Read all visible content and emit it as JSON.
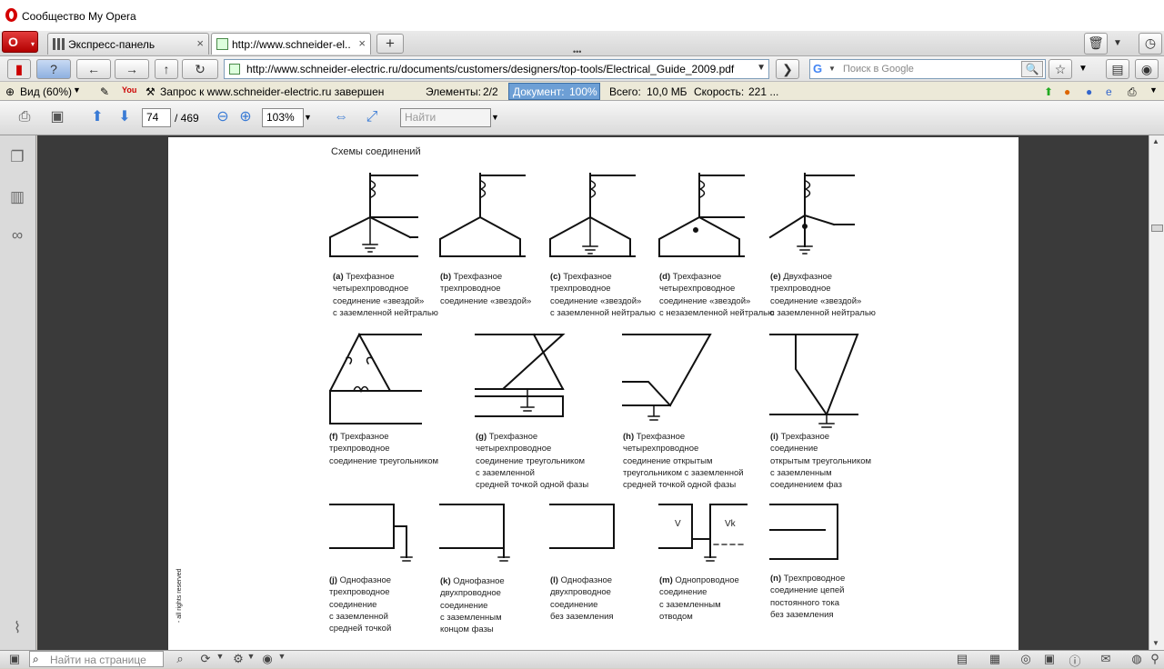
{
  "window": {
    "title": "Сообщество My Opera"
  },
  "menu": {
    "label": "O",
    "arrow": "▾"
  },
  "tabs": [
    {
      "label": "Экспресс-панель",
      "close": "×"
    },
    {
      "label": "http://www.schneider-el...",
      "close": "×"
    }
  ],
  "add_tab": "+",
  "tab_more": "•••",
  "nav": {
    "back": "←",
    "forward": "→",
    "up": "↑",
    "reload": "↻",
    "go": "❯",
    "address": "http://www.schneider-electric.ru/documents/customers/designers/top-tools/Electrical_Guide_2009.pdf",
    "address_drop": "▼",
    "search_engine": "G",
    "search_placeholder": "Поиск в Google",
    "search_btn": "🔍"
  },
  "status": {
    "view": "Вид (60%)",
    "request": "Запрос к www.schneider-electric.ru завершен",
    "elements_label": "Элементы:",
    "elements_value": "2/2",
    "document_label": "Документ:",
    "document_value": "100%",
    "total_label": "Всего:",
    "total_value": "10,0 МБ",
    "speed_label": "Скорость:",
    "speed_value": "221 ..."
  },
  "pdf": {
    "page": "74",
    "total": "/ 469",
    "zoom": "103%",
    "find_placeholder": "Найти"
  },
  "document": {
    "heading": "Схемы соединений",
    "captions": [
      {
        "tag": "(a)",
        "text": " Трехфазное\nчетырехпроводное\nсоединение «звездой»\nс заземленной нейтралью"
      },
      {
        "tag": "(b)",
        "text": " Трехфазное\nтрехпроводное\nсоединение «звездой»"
      },
      {
        "tag": "(c)",
        "text": " Трехфазное\nтрехпроводное\nсоединение «звездой»\nс заземленной нейтралью"
      },
      {
        "tag": "(d)",
        "text": " Трехфазное\nчетырехпроводное\nсоединение «звездой»\nс незаземленной нейтралью"
      },
      {
        "tag": "(e)",
        "text": " Двухфазное\nтрехпроводное\nсоединение «звездой»\nс заземленной нейтралью"
      },
      {
        "tag": "(f)",
        "text": " Трехфазное\nтрехпроводное\nсоединение треугольником"
      },
      {
        "tag": "(g)",
        "text": " Трехфазное\nчетырехпроводное\nсоединение треугольником\nс заземленной\nсредней точкой одной фазы"
      },
      {
        "tag": "(h)",
        "text": " Трехфазное\nчетырехпроводное\nсоединение открытым\nтреугольником с заземленной\nсредней точкой одной фазы"
      },
      {
        "tag": "(i)",
        "text": " Трехфазное\nсоединение\nоткрытым треугольником\nс заземленным\nсоединением фаз"
      },
      {
        "tag": "(j)",
        "text": " Однофазное\nтрехпроводное\nсоединение\nс заземленной\nсредней точкой"
      },
      {
        "tag": "(k)",
        "text": " Однофазное\nдвухпроводное\nсоединение\nс заземленным\nконцом фазы"
      },
      {
        "tag": "(l)",
        "text": " Однофазное\nдвухпроводное\nсоединение\nбез заземления"
      },
      {
        "tag": "(m)",
        "text": " Однопроводное\nсоединение\nс заземленным\nотводом"
      },
      {
        "tag": "(n)",
        "text": " Трехпроводное\nсоединение цепей\nпостоянного тока\nбез заземления"
      }
    ],
    "label_v": "V",
    "label_vk": "Vk",
    "side_text": "- all rights reserved"
  },
  "find": {
    "placeholder": "Найти на странице"
  }
}
